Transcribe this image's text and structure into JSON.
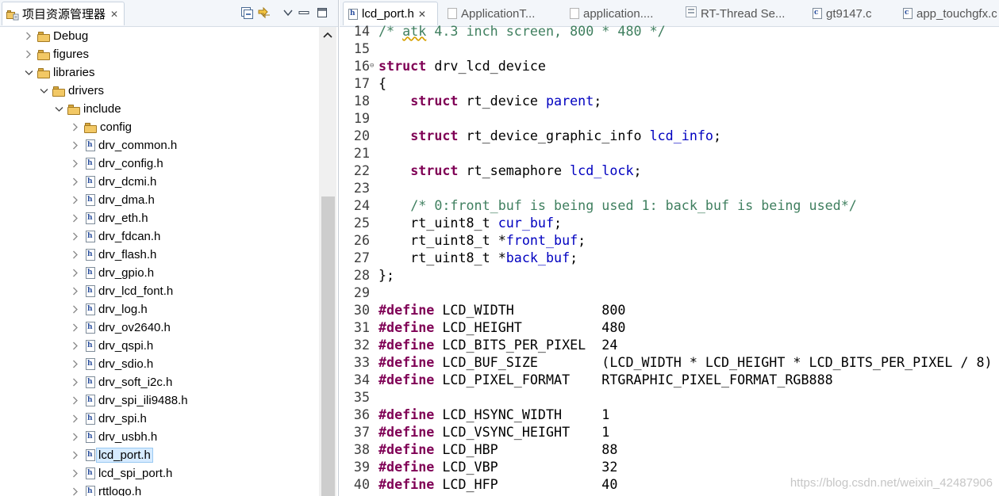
{
  "explorer": {
    "title": "项目资源管理器",
    "close_glyph": "✕",
    "tree": [
      {
        "label": "Debug",
        "type": "folder",
        "depth": 1,
        "twisty": "collapsed"
      },
      {
        "label": "figures",
        "type": "folder",
        "depth": 1,
        "twisty": "collapsed"
      },
      {
        "label": "libraries",
        "type": "folder",
        "depth": 1,
        "twisty": "expanded"
      },
      {
        "label": "drivers",
        "type": "folder",
        "depth": 2,
        "twisty": "expanded"
      },
      {
        "label": "include",
        "type": "folder",
        "depth": 3,
        "twisty": "expanded"
      },
      {
        "label": "config",
        "type": "folder",
        "depth": 4,
        "twisty": "collapsed"
      },
      {
        "label": "drv_common.h",
        "type": "file",
        "depth": 4,
        "twisty": "collapsed"
      },
      {
        "label": "drv_config.h",
        "type": "file",
        "depth": 4,
        "twisty": "collapsed"
      },
      {
        "label": "drv_dcmi.h",
        "type": "file",
        "depth": 4,
        "twisty": "collapsed"
      },
      {
        "label": "drv_dma.h",
        "type": "file",
        "depth": 4,
        "twisty": "collapsed"
      },
      {
        "label": "drv_eth.h",
        "type": "file",
        "depth": 4,
        "twisty": "collapsed"
      },
      {
        "label": "drv_fdcan.h",
        "type": "file",
        "depth": 4,
        "twisty": "collapsed"
      },
      {
        "label": "drv_flash.h",
        "type": "file",
        "depth": 4,
        "twisty": "collapsed"
      },
      {
        "label": "drv_gpio.h",
        "type": "file",
        "depth": 4,
        "twisty": "collapsed"
      },
      {
        "label": "drv_lcd_font.h",
        "type": "file",
        "depth": 4,
        "twisty": "collapsed"
      },
      {
        "label": "drv_log.h",
        "type": "file",
        "depth": 4,
        "twisty": "collapsed"
      },
      {
        "label": "drv_ov2640.h",
        "type": "file",
        "depth": 4,
        "twisty": "collapsed"
      },
      {
        "label": "drv_qspi.h",
        "type": "file",
        "depth": 4,
        "twisty": "collapsed"
      },
      {
        "label": "drv_sdio.h",
        "type": "file",
        "depth": 4,
        "twisty": "collapsed"
      },
      {
        "label": "drv_soft_i2c.h",
        "type": "file",
        "depth": 4,
        "twisty": "collapsed"
      },
      {
        "label": "drv_spi_ili9488.h",
        "type": "file",
        "depth": 4,
        "twisty": "collapsed"
      },
      {
        "label": "drv_spi.h",
        "type": "file",
        "depth": 4,
        "twisty": "collapsed"
      },
      {
        "label": "drv_usbh.h",
        "type": "file",
        "depth": 4,
        "twisty": "collapsed"
      },
      {
        "label": "lcd_port.h",
        "type": "file",
        "depth": 4,
        "twisty": "collapsed",
        "selected": true
      },
      {
        "label": "lcd_spi_port.h",
        "type": "file",
        "depth": 4,
        "twisty": "collapsed"
      },
      {
        "label": "rttlogo.h",
        "type": "file",
        "depth": 4,
        "twisty": "collapsed"
      }
    ]
  },
  "editor": {
    "tabs": [
      {
        "label": "lcd_port.h",
        "active": true,
        "close": "✕",
        "icon": "header-file-icon"
      },
      {
        "label": "ApplicationT...",
        "active": false,
        "icon": "document-icon"
      },
      {
        "label": "application....",
        "active": false,
        "icon": "document-icon"
      },
      {
        "label": "RT-Thread Se...",
        "active": false,
        "icon": "settings-icon"
      },
      {
        "label": "gt9147.c",
        "active": false,
        "icon": "c-file-icon"
      },
      {
        "label": "app_touchgfx.c",
        "active": false,
        "icon": "c-file-icon"
      }
    ],
    "lines": [
      {
        "n": "14",
        "parts": [
          [
            "cm",
            "/* "
          ],
          [
            "cm squig",
            "atk"
          ],
          [
            "cm",
            " 4.3 inch screen, 800 * 480 */"
          ]
        ]
      },
      {
        "n": "15",
        "parts": []
      },
      {
        "n": "16",
        "fold": "⊖",
        "parts": [
          [
            "kw",
            "struct"
          ],
          [
            "",
            " drv_lcd_device"
          ]
        ]
      },
      {
        "n": "17",
        "parts": [
          [
            "",
            "{"
          ]
        ]
      },
      {
        "n": "18",
        "parts": [
          [
            "",
            "    "
          ],
          [
            "kw",
            "struct"
          ],
          [
            "",
            " rt_device "
          ],
          [
            "fld",
            "parent"
          ],
          [
            "",
            ";"
          ]
        ]
      },
      {
        "n": "19",
        "parts": []
      },
      {
        "n": "20",
        "parts": [
          [
            "",
            "    "
          ],
          [
            "kw",
            "struct"
          ],
          [
            "",
            " rt_device_graphic_info "
          ],
          [
            "fld",
            "lcd_info"
          ],
          [
            "",
            ";"
          ]
        ]
      },
      {
        "n": "21",
        "parts": []
      },
      {
        "n": "22",
        "parts": [
          [
            "",
            "    "
          ],
          [
            "kw",
            "struct"
          ],
          [
            "",
            " rt_semaphore "
          ],
          [
            "fld",
            "lcd_lock"
          ],
          [
            "",
            ";"
          ]
        ]
      },
      {
        "n": "23",
        "parts": []
      },
      {
        "n": "24",
        "parts": [
          [
            "",
            "    "
          ],
          [
            "cm",
            "/* 0:front_buf is being used 1: back_buf is being used*/"
          ]
        ]
      },
      {
        "n": "25",
        "parts": [
          [
            "",
            "    rt_uint8_t "
          ],
          [
            "fld",
            "cur_buf"
          ],
          [
            "",
            ";"
          ]
        ]
      },
      {
        "n": "26",
        "parts": [
          [
            "",
            "    rt_uint8_t *"
          ],
          [
            "fld",
            "front_buf"
          ],
          [
            "",
            ";"
          ]
        ]
      },
      {
        "n": "27",
        "parts": [
          [
            "",
            "    rt_uint8_t *"
          ],
          [
            "fld",
            "back_buf"
          ],
          [
            "",
            ";"
          ]
        ]
      },
      {
        "n": "28",
        "parts": [
          [
            "",
            "};"
          ]
        ]
      },
      {
        "n": "29",
        "parts": []
      },
      {
        "n": "30",
        "parts": [
          [
            "kw",
            "#define"
          ],
          [
            "",
            " LCD_WIDTH           800"
          ]
        ]
      },
      {
        "n": "31",
        "parts": [
          [
            "kw",
            "#define"
          ],
          [
            "",
            " LCD_HEIGHT          480"
          ]
        ]
      },
      {
        "n": "32",
        "parts": [
          [
            "kw",
            "#define"
          ],
          [
            "",
            " LCD_BITS_PER_PIXEL  24"
          ]
        ]
      },
      {
        "n": "33",
        "parts": [
          [
            "kw",
            "#define"
          ],
          [
            "",
            " LCD_BUF_SIZE        (LCD_WIDTH * LCD_HEIGHT * LCD_BITS_PER_PIXEL / 8)"
          ]
        ]
      },
      {
        "n": "34",
        "parts": [
          [
            "kw",
            "#define"
          ],
          [
            "",
            " LCD_PIXEL_FORMAT    RTGRAPHIC_PIXEL_FORMAT_RGB888"
          ]
        ]
      },
      {
        "n": "35",
        "parts": []
      },
      {
        "n": "36",
        "parts": [
          [
            "kw",
            "#define"
          ],
          [
            "",
            " LCD_HSYNC_WIDTH     1"
          ]
        ]
      },
      {
        "n": "37",
        "parts": [
          [
            "kw",
            "#define"
          ],
          [
            "",
            " LCD_VSYNC_HEIGHT    1"
          ]
        ]
      },
      {
        "n": "38",
        "parts": [
          [
            "kw",
            "#define"
          ],
          [
            "",
            " LCD_HBP             88"
          ]
        ]
      },
      {
        "n": "39",
        "parts": [
          [
            "kw",
            "#define"
          ],
          [
            "",
            " LCD_VBP             32"
          ]
        ]
      },
      {
        "n": "40",
        "parts": [
          [
            "kw",
            "#define"
          ],
          [
            "",
            " LCD_HFP             40"
          ]
        ]
      }
    ]
  },
  "watermark": "https://blog.csdn.net/weixin_42487906",
  "colors": {
    "keyword": "#7f0055",
    "comment": "#3f7f5f",
    "field": "#0000c0",
    "selection": "#d6ebff"
  }
}
